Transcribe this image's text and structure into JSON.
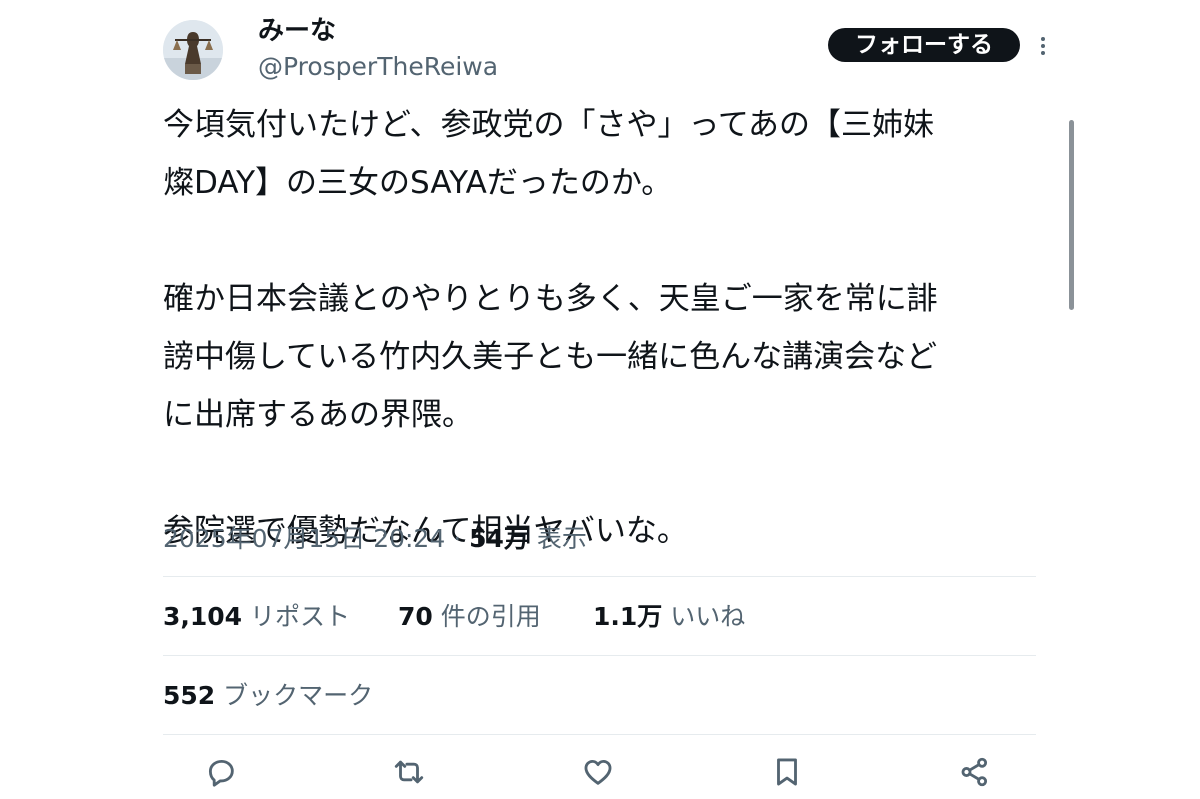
{
  "author": {
    "display_name": "みーな",
    "handle": "@ProsperTheReiwa",
    "avatar_icon": "justice-statue-avatar"
  },
  "header": {
    "follow_label": "フォローする",
    "more_icon": "more-dots-icon"
  },
  "tweet": {
    "paragraphs": [
      [
        "今頃気付いたけど、参政党の「さや」ってあの【三姉妹",
        "燦DAY】の三女のSAYAだったのか。"
      ],
      [
        "確か日本会議とのやりとりも多く、天皇ご一家を常に誹",
        "謗中傷している竹内久美子とも一緒に色んな講演会など",
        "に出席するあの界隈。"
      ],
      [
        "参院選で優勢だなんて相当ヤバいな。"
      ]
    ]
  },
  "meta": {
    "datetime": "2025年07月15日 20:24",
    "separator": "·",
    "views_count": "54万",
    "views_label": "表示"
  },
  "stats": {
    "reposts_count": "3,104",
    "reposts_label": "リポスト",
    "quotes_count": "70",
    "quotes_label": "件の引用",
    "likes_count": "1.1万",
    "likes_label": "いいね",
    "bookmarks_count": "552",
    "bookmarks_label": "ブックマーク"
  },
  "actions": [
    "reply-icon",
    "repost-icon",
    "like-icon",
    "bookmark-icon",
    "share-icon"
  ],
  "colors": {
    "text_primary": "#0f1419",
    "text_secondary": "#536471",
    "divider": "#e6ebee",
    "follow_bg": "#0f1419"
  }
}
